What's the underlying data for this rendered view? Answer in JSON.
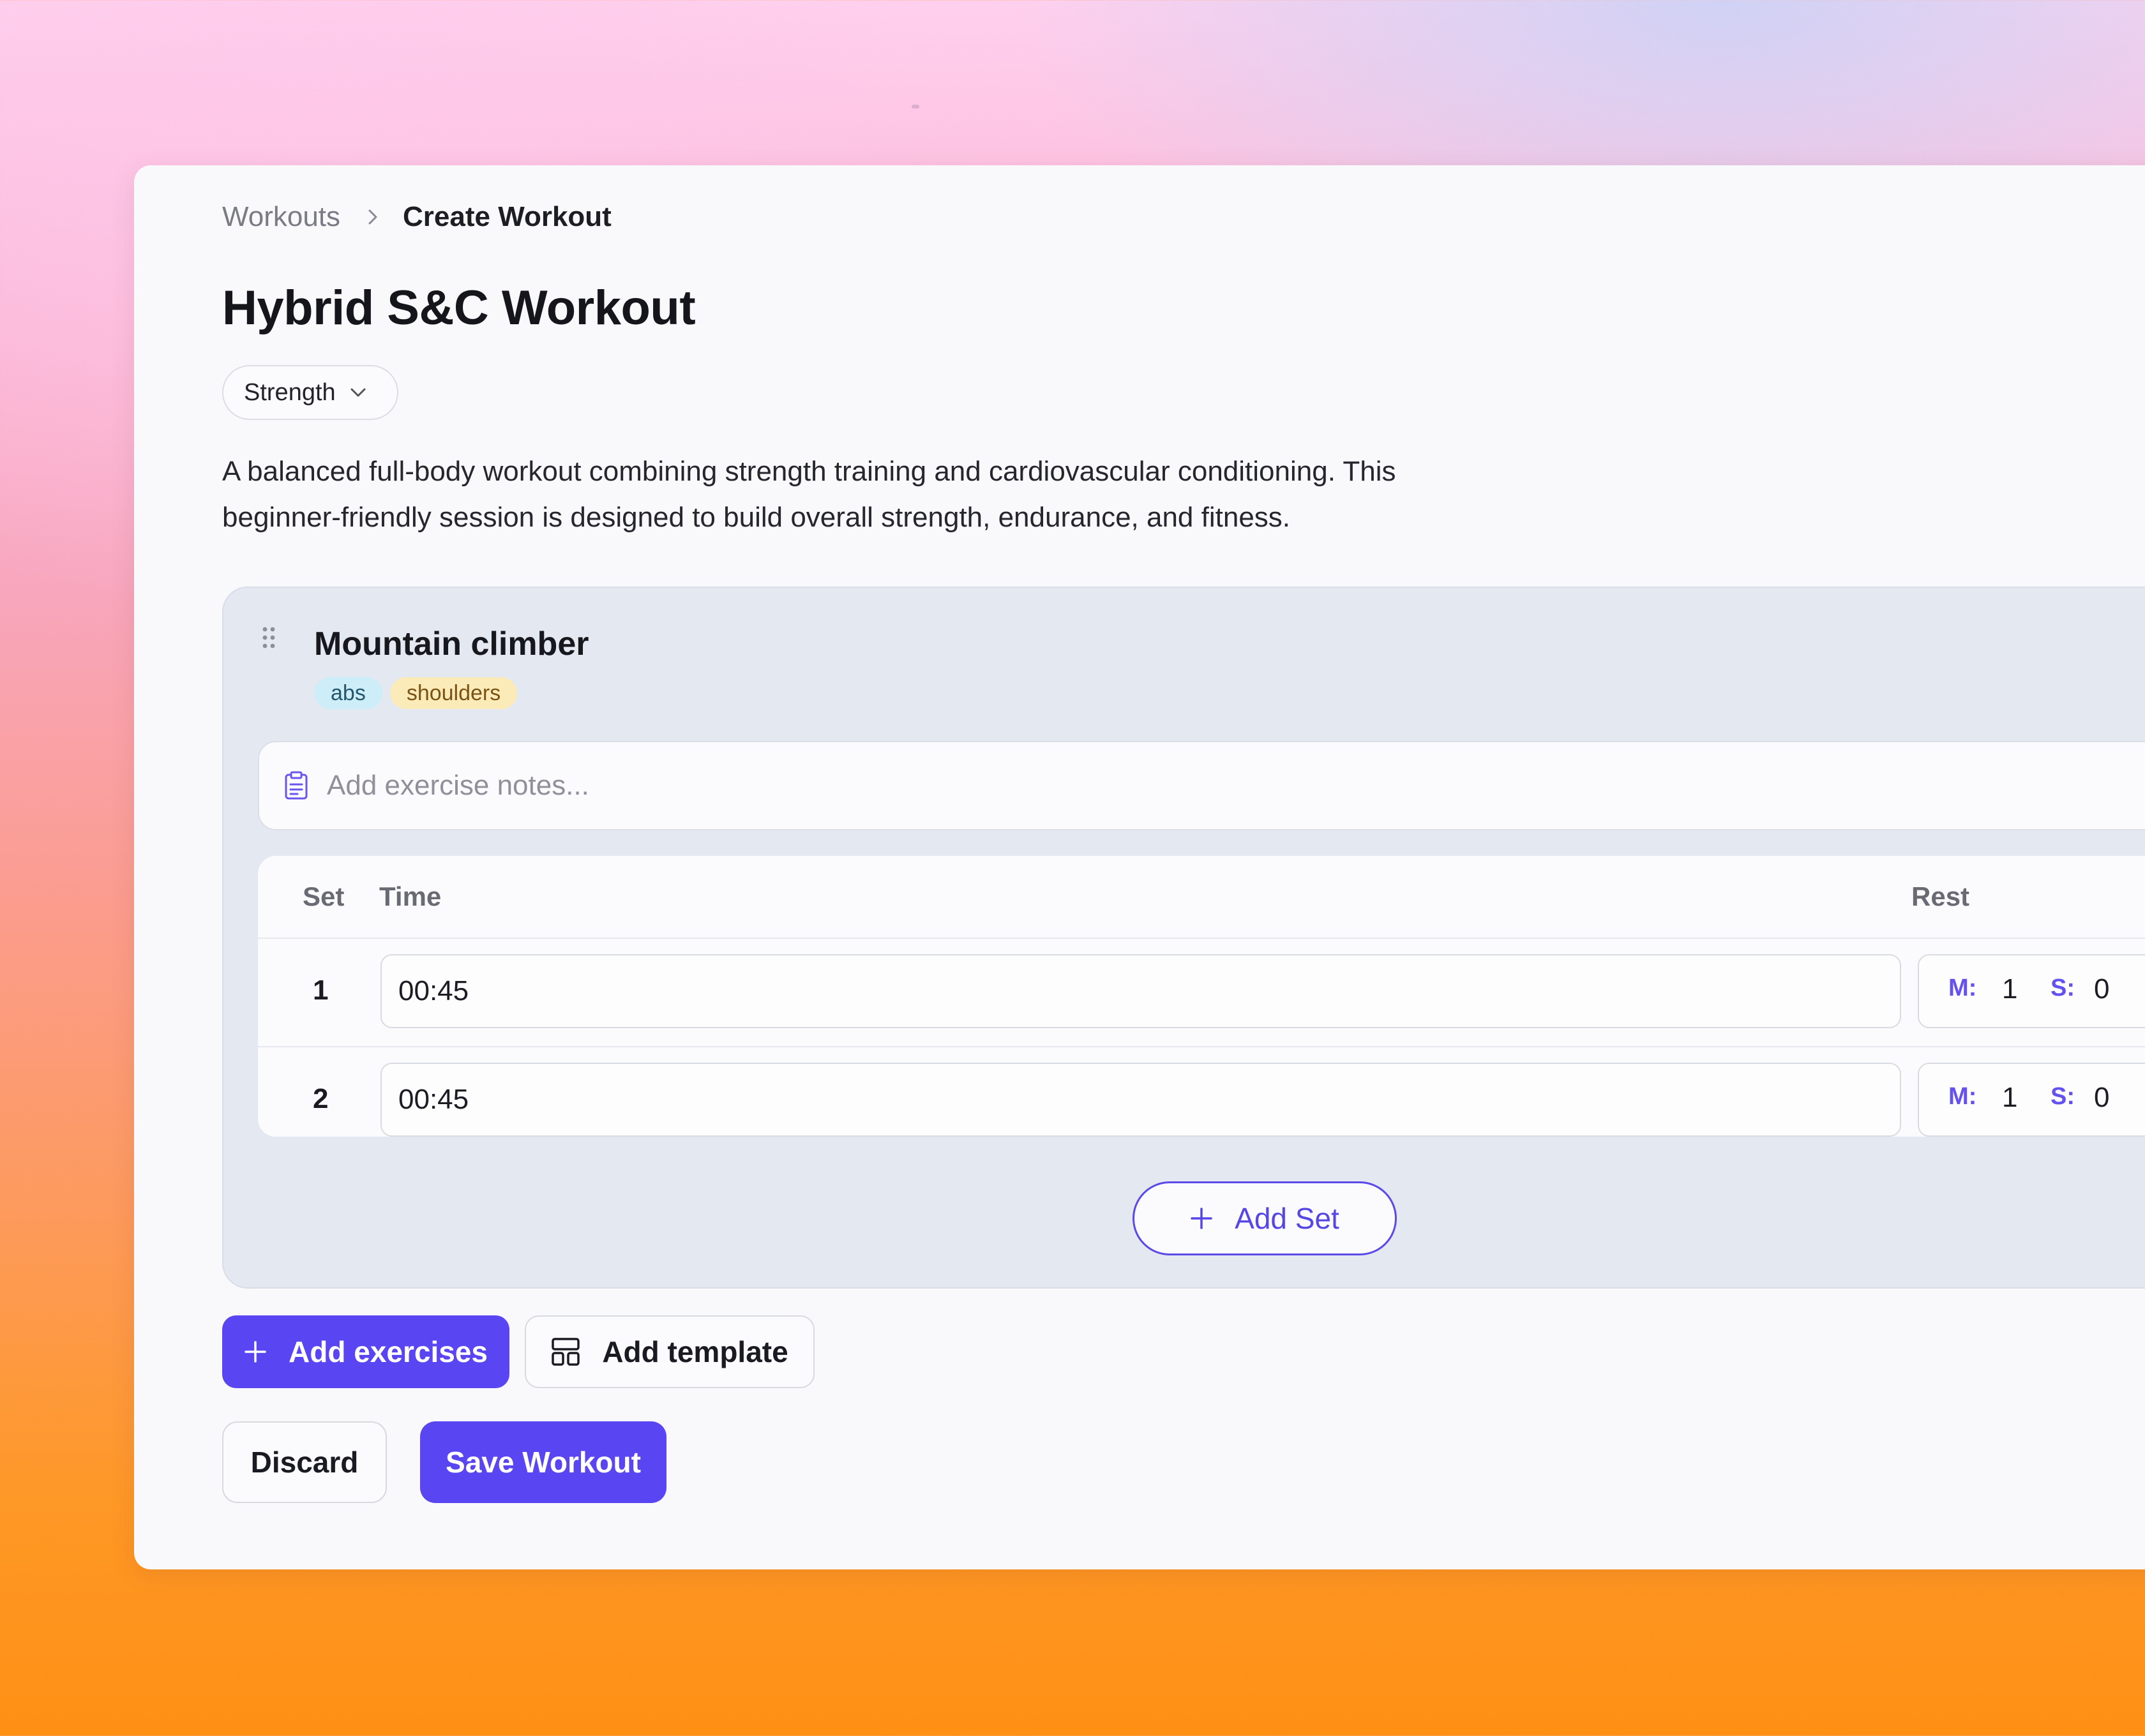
{
  "breadcrumb": {
    "parent": "Workouts",
    "current": "Create Workout"
  },
  "workout": {
    "title": "Hybrid S&C Workout",
    "category": "Strength",
    "description": "A balanced full-body workout combining strength training and cardiovascular conditioning. This beginner-friendly session is designed to build overall strength, endurance, and fitness."
  },
  "exercise": {
    "name": "Mountain climber",
    "tags": [
      "abs",
      "shoulders"
    ],
    "notes_placeholder": "Add exercise notes...",
    "notes_value": "",
    "columns": {
      "set": "Set",
      "time": "Time",
      "rest": "Rest"
    },
    "sets": [
      {
        "number": "1",
        "time": "00:45",
        "rest_m_label": "M:",
        "rest_m": "1",
        "rest_s_label": "S:",
        "rest_s": "0"
      },
      {
        "number": "2",
        "time": "00:45",
        "rest_m_label": "M:",
        "rest_m": "1",
        "rest_s_label": "S:",
        "rest_s": "0"
      }
    ],
    "add_set_label": "Add Set"
  },
  "actions": {
    "add_exercises": "Add exercises",
    "add_template": "Add template",
    "discard": "Discard",
    "save": "Save Workout"
  },
  "icons": {
    "breadcrumb_separator": "chevron-right-icon",
    "category_dropdown": "chevron-down-icon",
    "drag": "drag-handle-icon",
    "notes": "clipboard-icon",
    "add": "plus-icon",
    "template": "layout-template-icon"
  },
  "colors": {
    "accent": "#5a45f2",
    "tag_abs_bg": "#cdeef8",
    "tag_shoulders_bg": "#fbebb9",
    "card_bg": "#e3e8f1"
  }
}
